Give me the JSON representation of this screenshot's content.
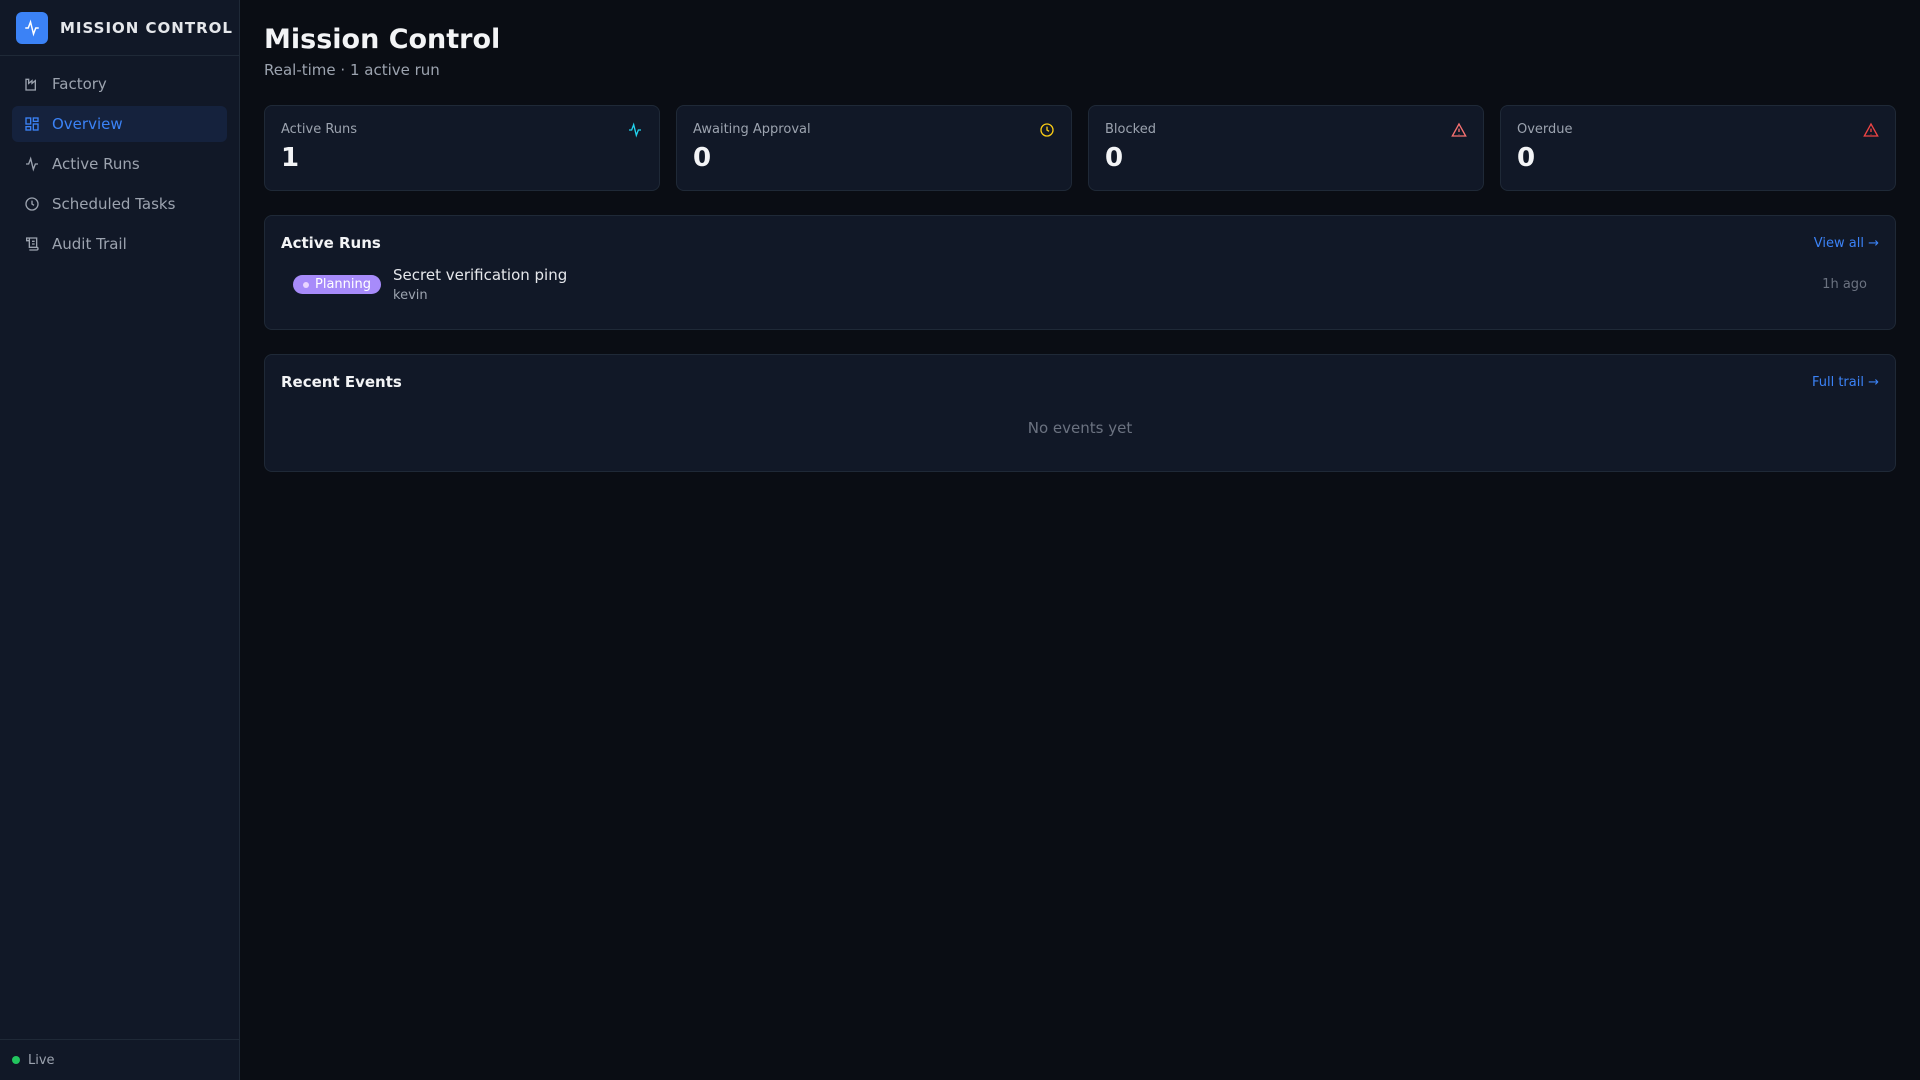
{
  "app": {
    "name": "MISSION CONTROL"
  },
  "sidebar": {
    "items": [
      {
        "label": "Factory",
        "icon": "factory-icon"
      },
      {
        "label": "Overview",
        "icon": "grid-icon",
        "active": true
      },
      {
        "label": "Active Runs",
        "icon": "activity-icon"
      },
      {
        "label": "Scheduled Tasks",
        "icon": "clock-icon"
      },
      {
        "label": "Audit Trail",
        "icon": "scroll-icon"
      }
    ],
    "status": "Live"
  },
  "header": {
    "title": "Mission Control",
    "subtitle": "Real-time · 1 active run"
  },
  "stats": [
    {
      "label": "Active Runs",
      "value": "1",
      "color": "#22d3ee"
    },
    {
      "label": "Awaiting Approval",
      "value": "0",
      "color": "#facc15"
    },
    {
      "label": "Blocked",
      "value": "0",
      "color": "#f87171"
    },
    {
      "label": "Overdue",
      "value": "0",
      "color": "#ef4444"
    }
  ],
  "active_runs": {
    "title": "Active Runs",
    "link": "View all →",
    "runs": [
      {
        "status": "Planning",
        "title": "Secret verification ping",
        "user": "kevin",
        "time": "1h ago"
      }
    ]
  },
  "recent_events": {
    "title": "Recent Events",
    "link": "Full trail →",
    "empty": "No events yet"
  }
}
